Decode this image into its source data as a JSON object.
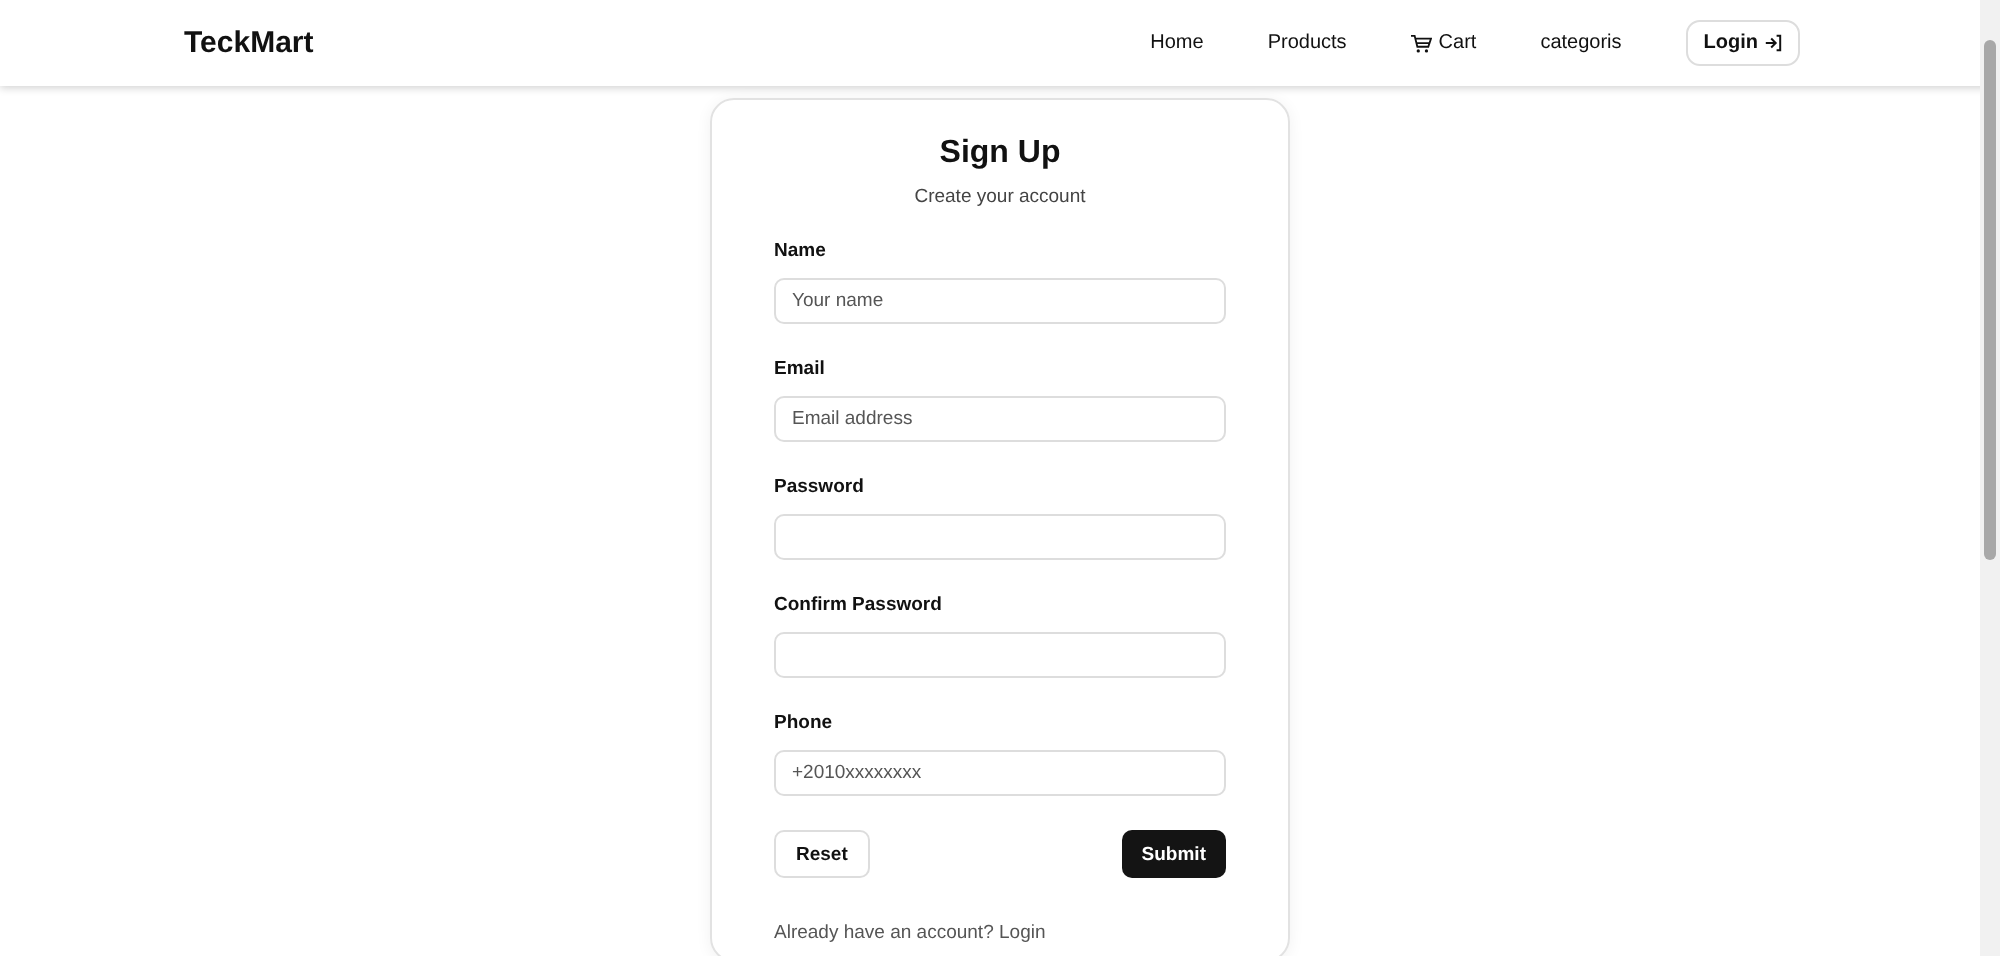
{
  "navbar": {
    "brand": "TeckMart",
    "links": [
      {
        "label": "Home",
        "kind": "text"
      },
      {
        "label": "Products",
        "kind": "text"
      },
      {
        "label": "Cart",
        "kind": "cart"
      },
      {
        "label": "categoris",
        "kind": "text"
      }
    ],
    "login_button": "Login"
  },
  "form": {
    "title": "Sign Up",
    "subtitle": "Create your account",
    "fields": [
      {
        "label": "Name",
        "placeholder": "Your name"
      },
      {
        "label": "Email",
        "placeholder": "Email address"
      },
      {
        "label": "Password"
      },
      {
        "label": "Confirm Password"
      },
      {
        "label": "Phone",
        "placeholder": "+2010xxxxxxxx"
      }
    ],
    "reset_button": "Reset",
    "submit_button": "Submit",
    "footer_prompt": "Already have an account?",
    "footer_link": "Login"
  }
}
